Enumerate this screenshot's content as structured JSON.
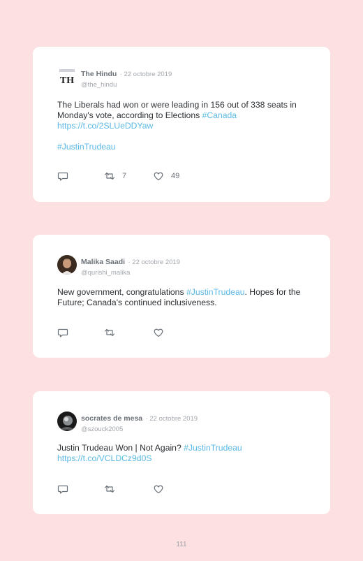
{
  "colors": {
    "background": "#fde0e2",
    "card": "#ffffff",
    "link": "#5ab8e4",
    "icon": "#6b7178"
  },
  "tweets": [
    {
      "name": "The Hindu",
      "date": "· 22 octobre 2019",
      "handle": "@the_hindu",
      "avatar_text": "TH",
      "text_1": "The Liberals had won or were leading in 156 out of 338 seats in Monday's vote, according to Elections ",
      "tag_1": "#Canada",
      "url": "https://t.co/2SLUeDDYaw",
      "tag_2": "#JustinTrudeau",
      "retweets": "7",
      "likes": "49"
    },
    {
      "name": "Malika Saadi",
      "date": "· 22 octobre 2019",
      "handle": "@qurishi_malika",
      "text_1": "New government, congratulations ",
      "tag_1": "#JustinTrudeau",
      "text_2": ". Hopes for the Future; Canada's continued inclusiveness."
    },
    {
      "name": "socrates de mesa",
      "date": "· 22 octobre 2019",
      "handle": "@szouck2005",
      "text_1": "Justin Trudeau Won | Not Again? ",
      "tag_1": "#JustinTrudeau",
      "url": "https://t.co/VCLDCz9d0S"
    }
  ],
  "icons": {
    "reply": "reply-icon",
    "retweet": "retweet-icon",
    "like": "heart-icon"
  },
  "page_number": "111"
}
